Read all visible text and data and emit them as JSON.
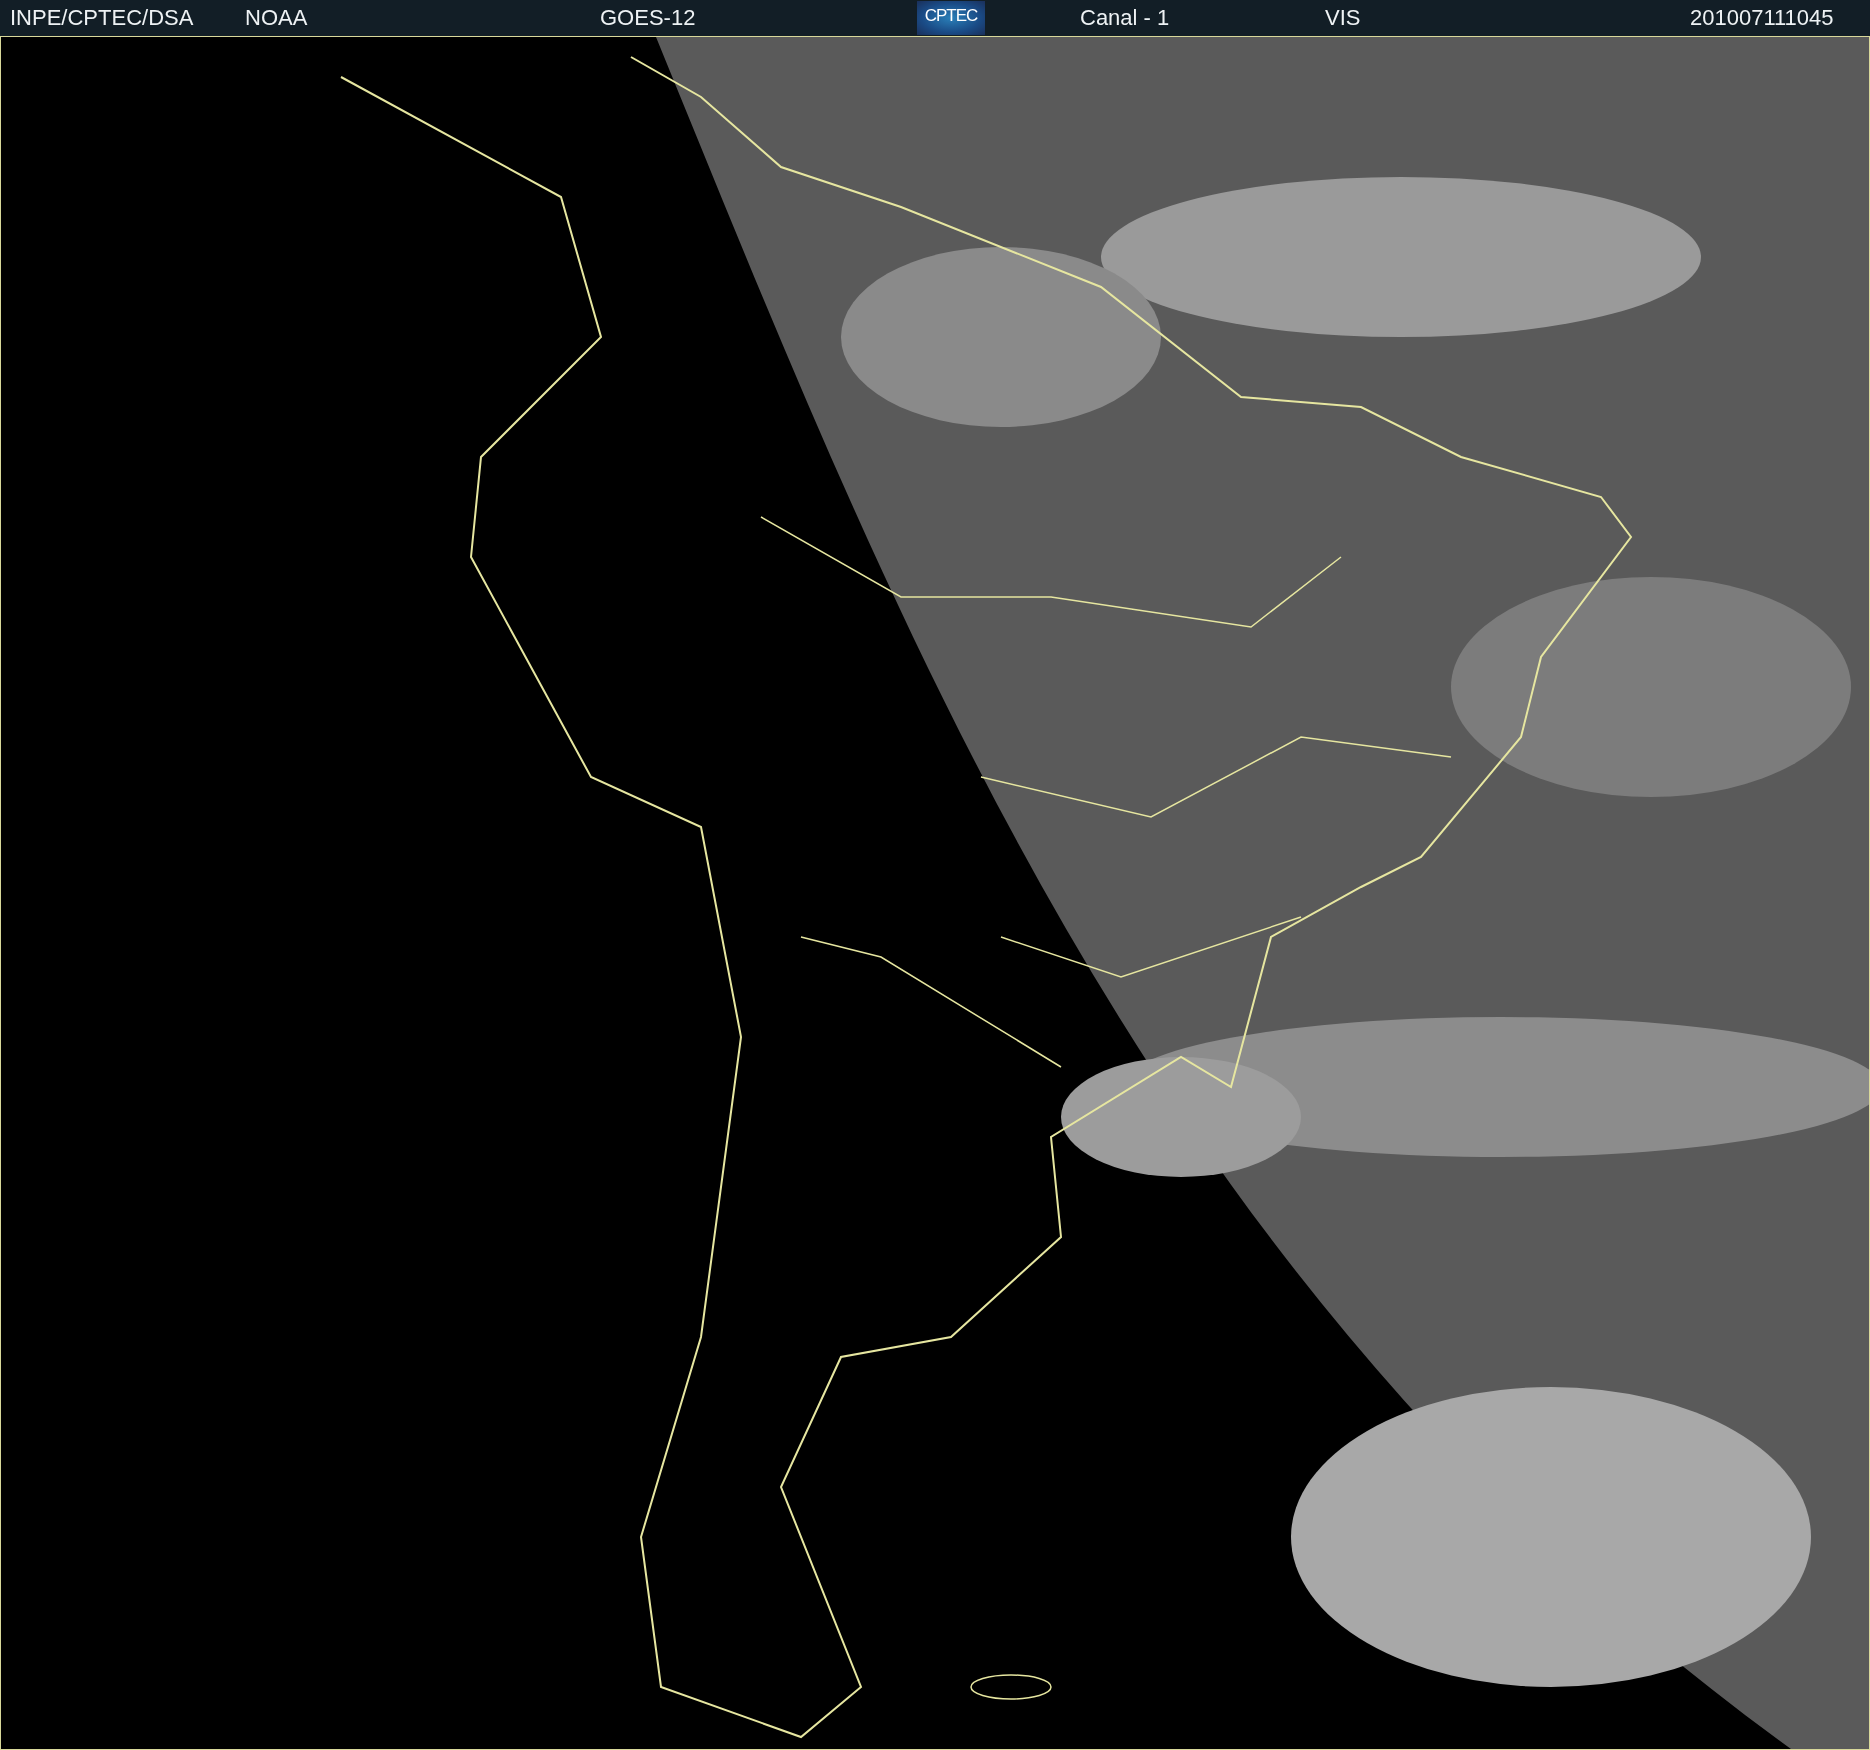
{
  "header": {
    "items": [
      {
        "kind": "text",
        "label": "INPE/CPTEC/DSA"
      },
      {
        "kind": "text",
        "label": "NOAA"
      },
      {
        "kind": "text",
        "label": "GOES-12"
      },
      {
        "kind": "logo",
        "label": "CPTEC"
      },
      {
        "kind": "text",
        "label": "Canal - 1"
      },
      {
        "kind": "text",
        "label": "VIS"
      },
      {
        "kind": "text",
        "label": "201007111045"
      }
    ]
  }
}
